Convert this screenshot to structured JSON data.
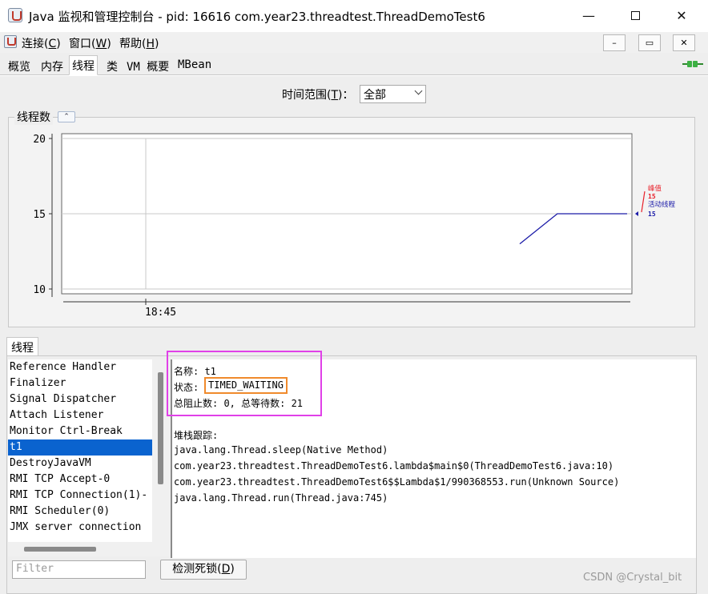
{
  "window": {
    "title": "Java 监视和管理控制台 - pid: 16616 com.year23.threadtest.ThreadDemoTest6",
    "min_icon": "minimize-icon",
    "max_icon": "maximize-icon",
    "close_icon": "close-icon"
  },
  "menu": {
    "items": [
      {
        "pre": "连接(",
        "key": "C",
        "post": ")"
      },
      {
        "pre": "窗口(",
        "key": "W",
        "post": ")"
      },
      {
        "pre": "帮助(",
        "key": "H",
        "post": ")"
      }
    ],
    "inner_controls": [
      "–",
      "▭",
      "✕"
    ]
  },
  "tabs": [
    {
      "label": "概览",
      "active": false
    },
    {
      "label": "内存",
      "active": false
    },
    {
      "label": "线程",
      "active": true
    },
    {
      "label": "类",
      "active": false
    },
    {
      "label": "VM 概要",
      "active": false
    },
    {
      "label": "MBean",
      "active": false
    }
  ],
  "time_range": {
    "label_pre": "时间范围(",
    "label_key": "T",
    "label_post": ")：",
    "selected": "全部"
  },
  "chart_title": "线程数",
  "chart_data": {
    "type": "line",
    "yticks": [
      10,
      15,
      20
    ],
    "ylim": [
      10,
      20
    ],
    "xticks": [
      "18:45"
    ],
    "series": [
      {
        "name": "峰值",
        "color": "#e8202a",
        "current": 15
      },
      {
        "name": "活动线程",
        "color": "#1c1ca8",
        "current": 15,
        "points": [
          [
            0,
            13
          ],
          [
            0.35,
            15
          ],
          [
            1,
            15
          ]
        ]
      }
    ]
  },
  "threads": {
    "tab_label": "线程",
    "list": [
      "Reference Handler",
      "Finalizer",
      "Signal Dispatcher",
      "Attach Listener",
      "Monitor Ctrl-Break",
      "t1",
      "DestroyJavaVM",
      "RMI TCP Accept-0",
      "RMI TCP Connection(1)-",
      "RMI Scheduler(0)",
      "JMX server connection"
    ],
    "selected_index": 5,
    "detail": {
      "name_line": "名称: t1",
      "state_label": "状态:",
      "state_value": "TIMED_WAITING",
      "counts_line": "总阻止数: 0, 总等待数: 21",
      "stack_title": "堆栈跟踪:",
      "stack": [
        "java.lang.Thread.sleep(Native Method)",
        "com.year23.threadtest.ThreadDemoTest6.lambda$main$0(ThreadDemoTest6.java:10)",
        "com.year23.threadtest.ThreadDemoTest6$$Lambda$1/990368553.run(Unknown Source)",
        "java.lang.Thread.run(Thread.java:745)"
      ]
    },
    "filter_placeholder": "Filter",
    "detect_pre": "检测死锁(",
    "detect_key": "D",
    "detect_post": ")"
  },
  "watermark": "CSDN @Crystal_bit",
  "colors": {
    "selection": "#0a63cf",
    "state_highlight": "#f08a2c",
    "region_highlight": "#e040e8"
  }
}
